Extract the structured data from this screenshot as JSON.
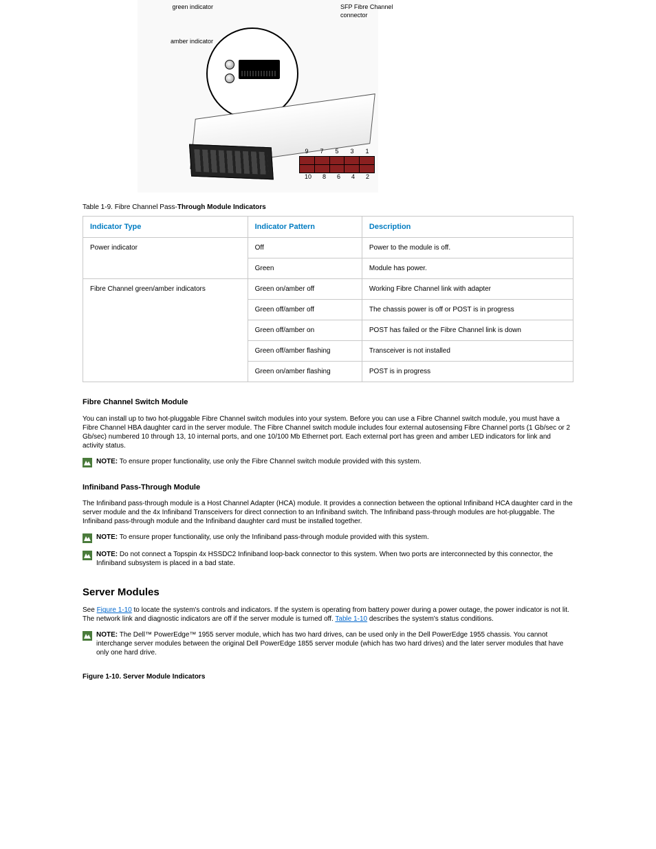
{
  "figureLabels": {
    "greenIndicator": "green indicator",
    "amberIndicator": "amber indicator",
    "sfpConnector": "SFP Fibre Channel connector",
    "portsTop": [
      "9",
      "7",
      "5",
      "3",
      "1"
    ],
    "portsBottom": [
      "10",
      "8",
      "6",
      "4",
      "2"
    ]
  },
  "table": {
    "titlePrefix": "  Table 1-9. Fibre Channel Pass-",
    "titleBold": "Through Module Indicators",
    "headers": [
      "Indicator Type",
      "Indicator Pattern",
      "Description"
    ],
    "rows": [
      {
        "type": "Power indicator",
        "pattern": "Off",
        "desc": "Power to the module is off.",
        "rowspan": 1
      },
      {
        "type": "",
        "pattern": "Green",
        "desc": "Module has power.",
        "rowspan": 0
      }
    ],
    "group": {
      "type": "Fibre Channel green/amber indicators",
      "rows": [
        {
          "pattern": "Green on/amber off",
          "desc": "Working Fibre Channel link with adapter"
        },
        {
          "pattern": "Green off/amber off",
          "desc": "The chassis power is off or POST is in progress"
        },
        {
          "pattern": "Green off/amber on",
          "desc": "POST has failed or the Fibre Channel link is down"
        },
        {
          "pattern": "Green off/amber flashing",
          "desc": "Transceiver is not installed"
        },
        {
          "pattern": "Green on/amber flashing",
          "desc": "POST is in progress"
        }
      ]
    }
  },
  "fcSwitch": {
    "heading": "Fibre Channel Switch Module",
    "para1a": "You can install up to two hot-pluggable Fibre Channel switch modules into your system. Before you can use a Fibre Channel switch module, you must have a Fibre Channel HBA daughter card in the server module. The Fibre Channel switch module includes four external autosensing Fibre Channel ports (1 Gb/sec or 2 Gb/sec) numbered 10 through 13, 10 internal ports, and",
    "para1b": " one 10/100 Mb Ethernet port. Each external port has green and amber LED indicators for link and activity status.",
    "note": {
      "label": "NOTE:",
      "text": " To ensure proper functionality, use only the Fibre Channel switch module provided with this system."
    }
  },
  "infini": {
    "heading": "Infiniband Pass-Through Module",
    "para1a": "The Infiniband pass-through module is a Host Channel Adapter (HCA) module. It provides a connection between the optional Infiniband HCA daughter card in the server module and the 4x Infiniband Transceivers for direct connection to an Infiniband switch. The Infiniband pass",
    "para1b": "-through modules are hot-pluggable. The Infiniband pass-through module and the Infiniband daughter card must be installed together.",
    "note1": {
      "label": "NOTE:",
      "text": " To ensure proper functionality, use only the Infiniband pass-through module provided with this system."
    },
    "note2": {
      "label": "NOTE:",
      "text": " Do not connect a Topspin 4x HSSDC2 Infiniband loop-back connector to this system. When two ports are interconnected by this connector, the Infiniband subsystem is placed in a bad state."
    }
  },
  "serverModules": {
    "heading": "Server Modules",
    "para1a": "See ",
    "linkFig": "Figure 1-10",
    "para1b": " to locate the system's controls and indicators. If the system is operating from battery power during a power outage, the power indicator is not lit. The network link and diagnostic indicators are off if the server module is turned off. ",
    "linkTbl": "Table 1-10",
    "para1c": " describes the system's status conditions.",
    "note": {
      "label": "NOTE:",
      "text": " The Dell™ PowerEdge™ 1955 server module, which has two hard drives, can be used only in the Dell PowerEdge 1955 chassis. You cannot interchange server modules between the original Dell PowerEdge 1855 server module (which has two hard drives) and the later server modules that have only one hard drive."
    },
    "figTitle": "Figure 1-10. Server Module Indicators"
  }
}
